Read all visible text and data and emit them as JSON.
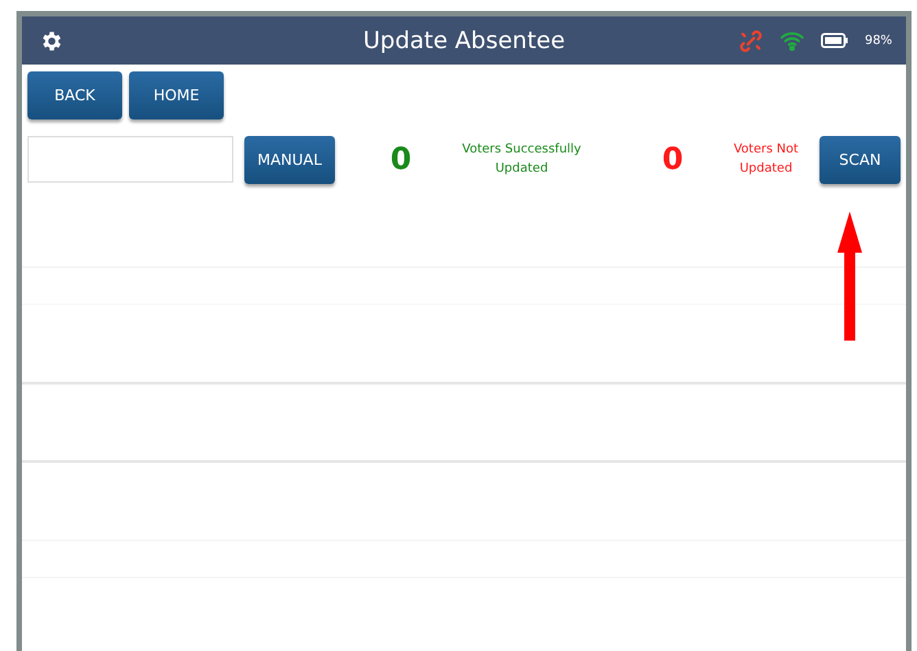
{
  "header": {
    "title": "Update Absentee",
    "battery_percent": "98%"
  },
  "nav_buttons": [
    "BACK",
    "HOME"
  ],
  "entry": {
    "button": "MANUAL"
  },
  "counters": [
    {
      "count": "0",
      "label": "Voters Successfully Updated",
      "color": "#1a8a1a"
    },
    {
      "count": "0",
      "label": "Voters Not Updated",
      "color": "#ff1a1a"
    }
  ],
  "scan_button": "SCAN"
}
